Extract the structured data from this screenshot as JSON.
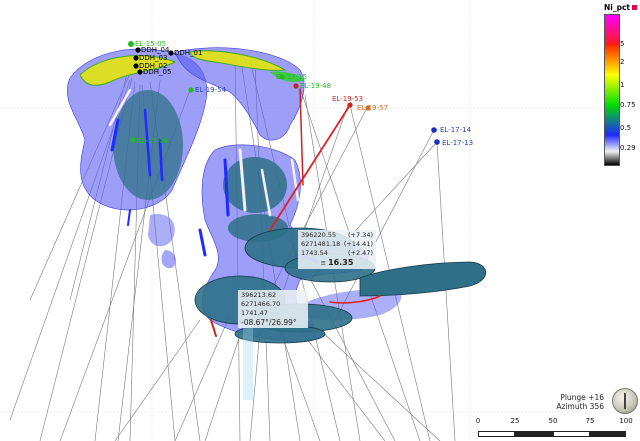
{
  "legend": {
    "title": "Ni_pct",
    "ticks": [
      "5",
      "2",
      "1",
      "0.75",
      "0.5",
      "0.29"
    ],
    "colors": [
      "#ff00ff",
      "#ff1a1a",
      "#ffff00",
      "#00dd00",
      "#1e2aff",
      "#f2f2f2",
      "#000000"
    ]
  },
  "drillholes": [
    {
      "label": "EL-15-05",
      "color": "#22bb22"
    },
    {
      "label": "DDH_04",
      "color": "#000000"
    },
    {
      "label": "DDH_03",
      "color": "#000000"
    },
    {
      "label": "DDH_01",
      "color": "#000000"
    },
    {
      "label": "DDH_02",
      "color": "#000000"
    },
    {
      "label": "DDH_05",
      "color": "#000000"
    },
    {
      "label": "EL-19-54",
      "color": "#2244bb"
    },
    {
      "label": "EL-17-15",
      "color": "#22bb22"
    },
    {
      "label": "EL-19-48",
      "color": "#22bb22"
    },
    {
      "label": "EL-19-53",
      "color": "#cc2222"
    },
    {
      "label": "EL-19-57",
      "color": "#dd6622"
    },
    {
      "label": "EL-17-14",
      "color": "#2244bb"
    },
    {
      "label": "EL-17-13",
      "color": "#2244bb"
    },
    {
      "label": "EL-15-04",
      "color": "#22bb22"
    }
  ],
  "readouts": [
    {
      "coords": [
        "396220.55",
        "6271481.18",
        "1743.54"
      ],
      "deltas": [
        "(+7.34)",
        "(+14.41)",
        "(+2.47)"
      ],
      "value": "16.35"
    },
    {
      "coords": [
        "396213.62",
        "6271466.70",
        "1741.47"
      ],
      "value": "-08.67°/26.99°"
    }
  ],
  "orientation": {
    "plunge": "Plunge +16",
    "azimuth": "Azimuth 356"
  },
  "scale": {
    "ticks": [
      "0",
      "25",
      "50",
      "75",
      "100"
    ]
  },
  "chrome_colors": {
    "mesh_blue": "#5a5ef2",
    "ore_teal": "#2f7088",
    "trace_gray": "#808080"
  }
}
